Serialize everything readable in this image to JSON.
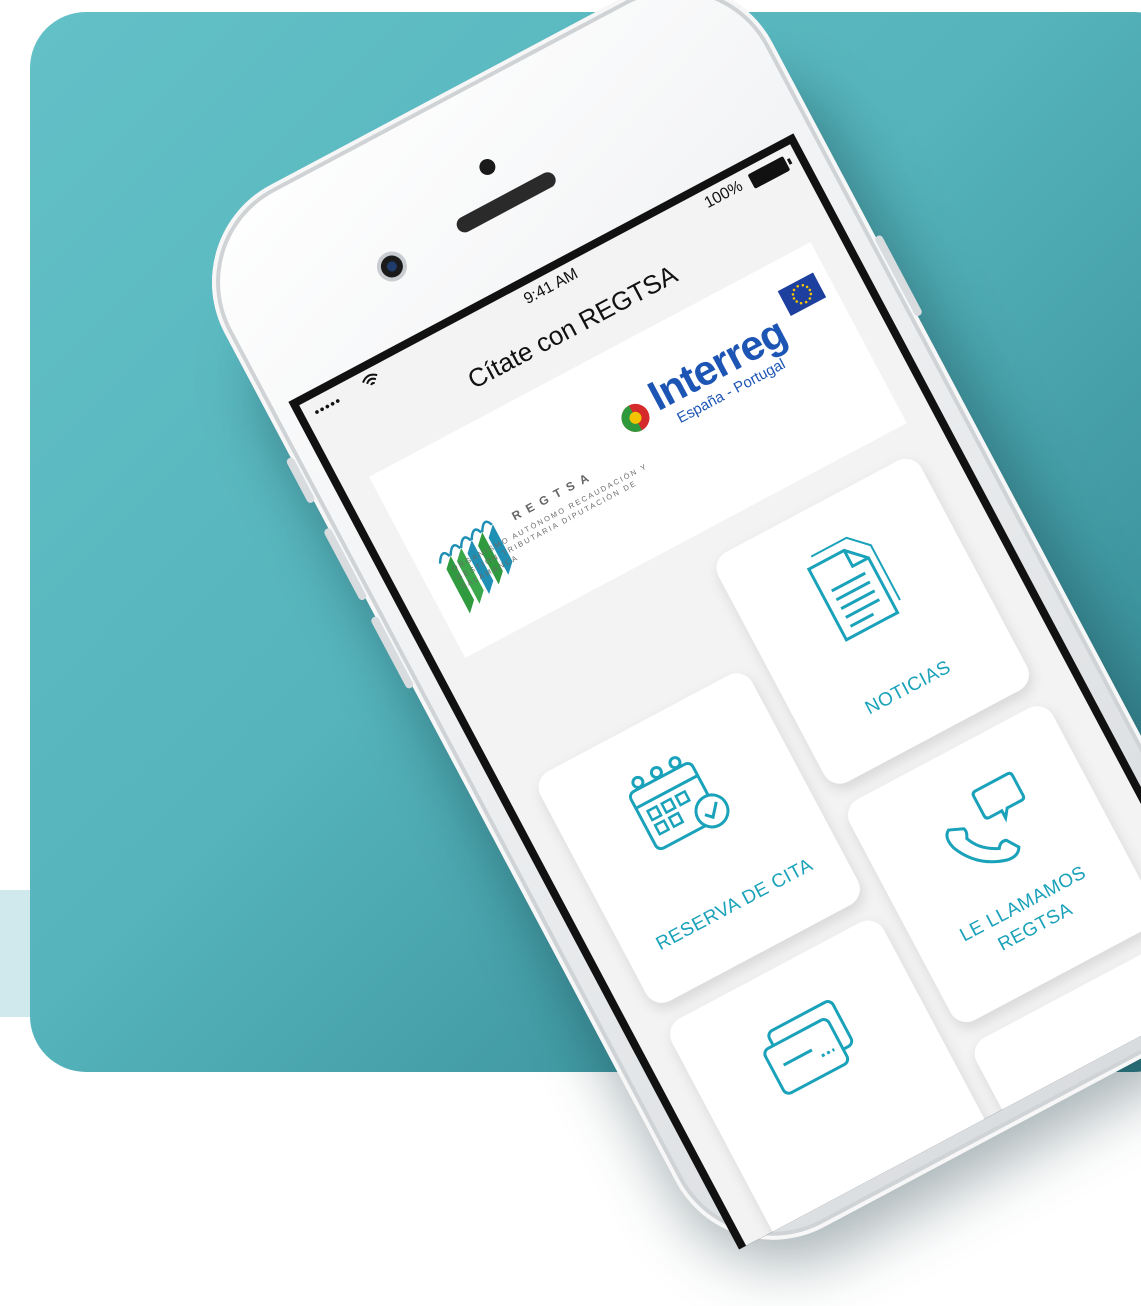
{
  "status_bar": {
    "signal": "•••••",
    "time": "9:41 AM",
    "battery": "100%"
  },
  "nav": {
    "title": "Cítate con REGTSA"
  },
  "banner": {
    "regtsa_name": "REGTSA",
    "regtsa_subtitle": "ORGANISMO AUTÓNOMO RECAUDACIÓN Y GESTIÓN TRIBUTARIA DIPUTACIÓN DE SALAMANCA",
    "interreg_word": "Interreg",
    "interreg_subtitle": "España - Portugal"
  },
  "tiles": {
    "reserva": {
      "label": "RESERVA DE CITA",
      "icon": "calendar-check-icon"
    },
    "noticias": {
      "label": "NOTICIAS",
      "icon": "document-icon"
    },
    "llamamos": {
      "label_line1": "LE LLAMAMOS",
      "label_line2": "REGTSA",
      "icon": "phone-chat-icon"
    },
    "mensajes": {
      "icon": "chat-card-icon"
    }
  },
  "colors": {
    "background_teal": "#55b4bc",
    "accent": "#1aa2ba",
    "interreg_blue": "#1d55b5"
  }
}
